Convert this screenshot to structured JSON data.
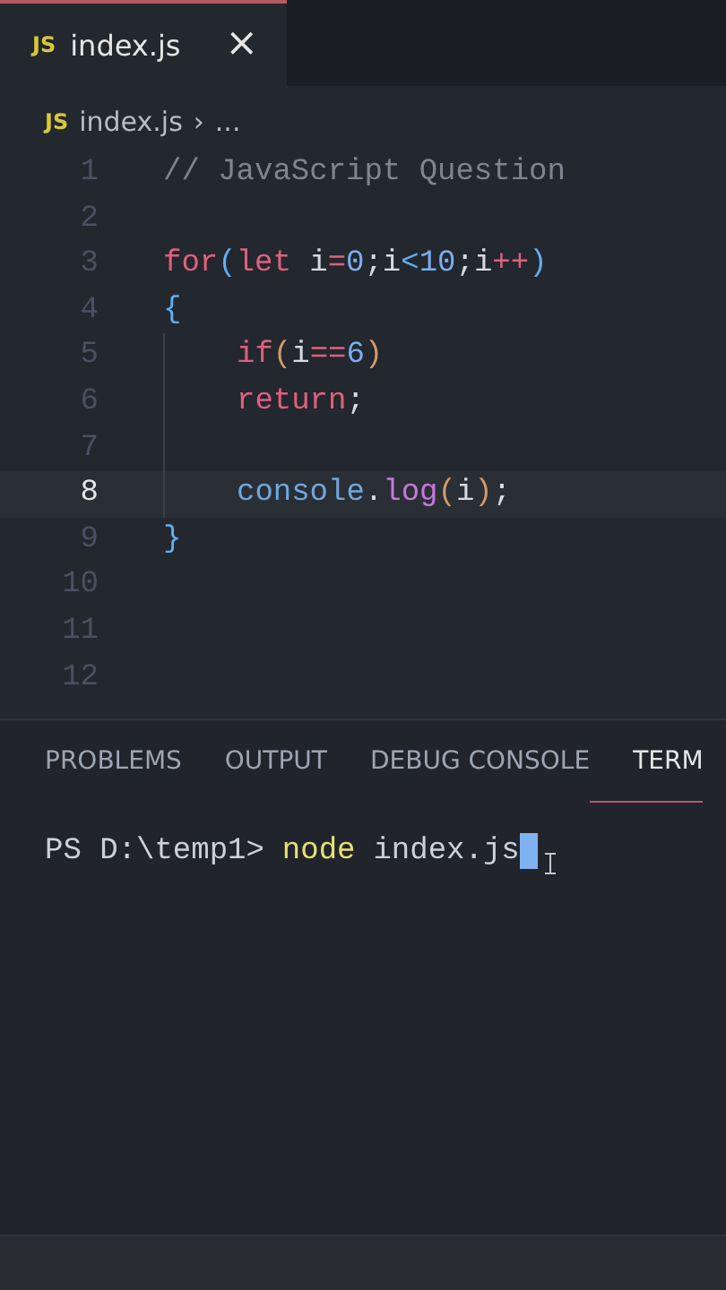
{
  "tab": {
    "icon": "JS",
    "label": "index.js",
    "close": "×",
    "selected": true
  },
  "breadcrumb": {
    "icon": "JS",
    "file": "index.js",
    "separator": "›",
    "rest": "..."
  },
  "editor": {
    "lines": [
      {
        "number": "1",
        "current": false,
        "indented": false,
        "tokens": [
          {
            "t": "// JavaScript Question",
            "kind": "comment"
          }
        ]
      },
      {
        "number": "2",
        "current": false,
        "indented": false
      },
      {
        "number": "3",
        "current": false,
        "indented": false,
        "tokens": [
          {
            "t": "for",
            "kind": "keyword"
          },
          {
            "t": "(",
            "kind": "bracket"
          },
          {
            "t": "let",
            "kind": "keyword"
          },
          {
            "t": " i",
            "kind": "plain"
          },
          {
            "t": "=",
            "kind": "keyword"
          },
          {
            "t": "0",
            "kind": "number"
          },
          {
            "t": ";i",
            "kind": "plain"
          },
          {
            "t": "<",
            "kind": "bracket"
          },
          {
            "t": "10",
            "kind": "number"
          },
          {
            "t": ";i",
            "kind": "plain"
          },
          {
            "t": "++",
            "kind": "keyword"
          },
          {
            "t": ")",
            "kind": "bracket"
          }
        ]
      },
      {
        "number": "4",
        "current": false,
        "indented": false,
        "tokens": [
          {
            "t": "{",
            "kind": "bracket"
          }
        ]
      },
      {
        "number": "5",
        "current": false,
        "indented": true,
        "tokens": [
          {
            "t": "if",
            "kind": "keyword"
          },
          {
            "t": "(",
            "kind": "paren"
          },
          {
            "t": "i",
            "kind": "plain"
          },
          {
            "t": "==",
            "kind": "keyword"
          },
          {
            "t": "6",
            "kind": "number"
          },
          {
            "t": ")",
            "kind": "paren"
          }
        ]
      },
      {
        "number": "6",
        "current": false,
        "indented": true,
        "tokens": [
          {
            "t": "return",
            "kind": "keyword"
          },
          {
            "t": ";",
            "kind": "plain"
          }
        ]
      },
      {
        "number": "7",
        "current": false,
        "indented": true
      },
      {
        "number": "8",
        "current": true,
        "indented": true,
        "tokens": [
          {
            "t": "console",
            "kind": "object"
          },
          {
            "t": ".",
            "kind": "plain"
          },
          {
            "t": "log",
            "kind": "function"
          },
          {
            "t": "(",
            "kind": "paren"
          },
          {
            "t": "i",
            "kind": "plain"
          },
          {
            "t": ")",
            "kind": "paren"
          },
          {
            "t": ";",
            "kind": "plain"
          }
        ]
      },
      {
        "number": "9",
        "current": false,
        "indented": false,
        "tokens": [
          {
            "t": "}",
            "kind": "bracket"
          }
        ]
      },
      {
        "number": "10",
        "current": false,
        "indented": false
      },
      {
        "number": "11",
        "current": false,
        "indented": false
      },
      {
        "number": "12",
        "current": false,
        "indented": false
      }
    ]
  },
  "panel": {
    "tabs": [
      {
        "label": "PROBLEMS",
        "selected": false
      },
      {
        "label": "OUTPUT",
        "selected": false
      },
      {
        "label": "DEBUG CONSOLE",
        "selected": false
      },
      {
        "label": "TERM",
        "selected": true
      }
    ]
  },
  "terminal": {
    "prompt": "PS D:\\temp1>",
    "command": "node",
    "args": "index.js"
  }
}
